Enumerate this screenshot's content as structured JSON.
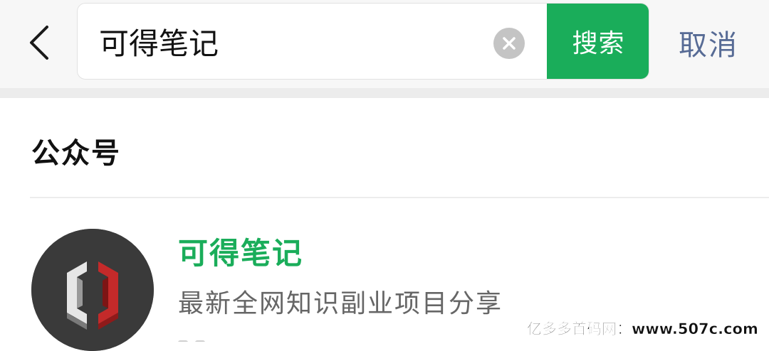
{
  "header": {
    "back_icon": "chevron-left-icon",
    "search": {
      "value": "可得笔记",
      "clear_icon": "clear-circle-icon"
    },
    "search_button_label": "搜索",
    "cancel_label": "取消",
    "accent_color": "#1aad5a",
    "link_color": "#576b95"
  },
  "section": {
    "title": "公众号"
  },
  "account": {
    "name": "可得笔记",
    "description": "最新全网知识副业项目分享",
    "avatar_icon": "hexagon-logo-icon"
  },
  "watermark": {
    "text": "亿多多首码网：www.507c.com"
  }
}
